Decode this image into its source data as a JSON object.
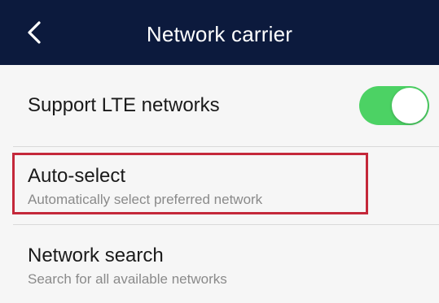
{
  "header": {
    "title": "Network carrier",
    "back_icon": "chevron-left-icon"
  },
  "lte": {
    "label": "Support LTE networks",
    "toggle_on": true,
    "toggle_color": "#4cd264"
  },
  "auto_select": {
    "label": "Auto-select",
    "description": "Automatically select preferred network",
    "highlight_color": "#c4283a"
  },
  "network_search": {
    "label": "Network search",
    "description": "Search for all available networks"
  }
}
